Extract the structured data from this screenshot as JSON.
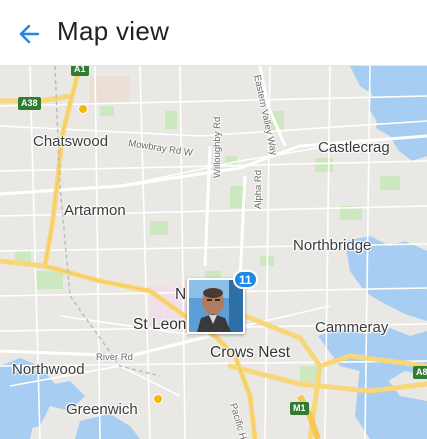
{
  "app_bar": {
    "title": "Map view",
    "back_icon": "arrow-left-icon",
    "accent_color": "#1e88e5"
  },
  "map": {
    "suburbs": {
      "chatswood": "Chatswood",
      "artarmon": "Artarmon",
      "castlecrag": "Castlecrag",
      "northbridge": "Northbridge",
      "st_leonards": "St Leon",
      "crows_nest": "Crows Nest",
      "cammeray": "Cammeray",
      "northwood": "Northwood",
      "greenwich": "Greenwich",
      "naremburn_partial": "N"
    },
    "roads": {
      "mowbray": "Mowbray Rd W",
      "eastern_valley": "Eastern Valley Way",
      "willoughby": "Willoughby Rd",
      "alpha": "Alpha Rd",
      "river": "River Rd",
      "pacific": "Pacific H"
    },
    "shields": {
      "a1": "A1",
      "a38": "A38",
      "m1": "M1",
      "a8": "A8"
    },
    "marker": {
      "photo_count": "11"
    }
  }
}
